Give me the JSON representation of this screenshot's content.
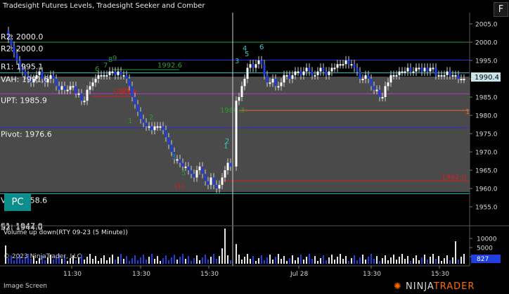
{
  "window": {
    "title": "Tradesight Futures Levels, Tradesight Seeker and Comber",
    "button": "F"
  },
  "chart": {
    "price_axis_ticks": [
      "2005.0",
      "2000.0",
      "1995.0",
      "1990.0",
      "1985.0",
      "1980.0",
      "1975.0",
      "1970.0",
      "1965.0",
      "1960.0",
      "1955.0"
    ],
    "current_price": "1990.4",
    "levels": [
      {
        "label": "R2: 2000.0",
        "value": 2000.0,
        "color": "#2e9a2e"
      },
      {
        "label": "R1: 1995.1",
        "value": 1995.1,
        "color": "#2a2ae0"
      },
      {
        "label": "VAH: 1991.6",
        "value": 1991.6,
        "color": "#2fc7c7"
      },
      {
        "label": "UPT: 1985.9",
        "value": 1985.9,
        "color": "#b040c0"
      },
      {
        "label": "Pivot: 1976.6",
        "value": 1976.6,
        "color": "#2a2ae0"
      },
      {
        "label": "VAL: 1958.6",
        "value": 1958.6,
        "color": "#2fc7c7"
      }
    ],
    "overlap_labels": [
      "S1: 1947.0",
      "S2: 1944.0"
    ],
    "annotations": [
      {
        "text": "1992.6",
        "color": "#2e9a2e"
      },
      {
        "text": "1985.8",
        "color": "#d42020"
      },
      {
        "text": "1980.3",
        "color": "#2e9a2e"
      },
      {
        "text": "1962.0",
        "color": "#d42020"
      },
      {
        "text": "1",
        "color": "#e07030"
      }
    ],
    "seeker_numbers_green": [
      "1",
      "2",
      "3",
      "5",
      "6",
      "7",
      "8",
      "9"
    ],
    "seeker_numbers_cyan": [
      "1",
      "2",
      "3",
      "4",
      "5",
      "6"
    ],
    "seeker_numbers_red": [
      "(1)",
      "(2)"
    ]
  },
  "volume": {
    "title": "Volume up down(RTY 09-23 (5 Minute))",
    "axis_ticks": [
      "10000",
      "5000",
      "2000"
    ],
    "current_value": "827",
    "copyright": "© 2023 NinjaTrader, LLC"
  },
  "time_axis": {
    "labels": [
      "11:30",
      "13:30",
      "15:30",
      "Jul 28",
      "13:30",
      "15:30"
    ]
  },
  "pc_button": "PC",
  "footer": {
    "image_screen": "Image Screen",
    "logo_main": "NINJA",
    "logo_accent": "TRADER"
  },
  "colors": {
    "up_bar": "#ffffff",
    "down_bar": "#1f3fe0",
    "value_area": "#4a4a4a",
    "current_price_bg": "#c8e4ea"
  }
}
